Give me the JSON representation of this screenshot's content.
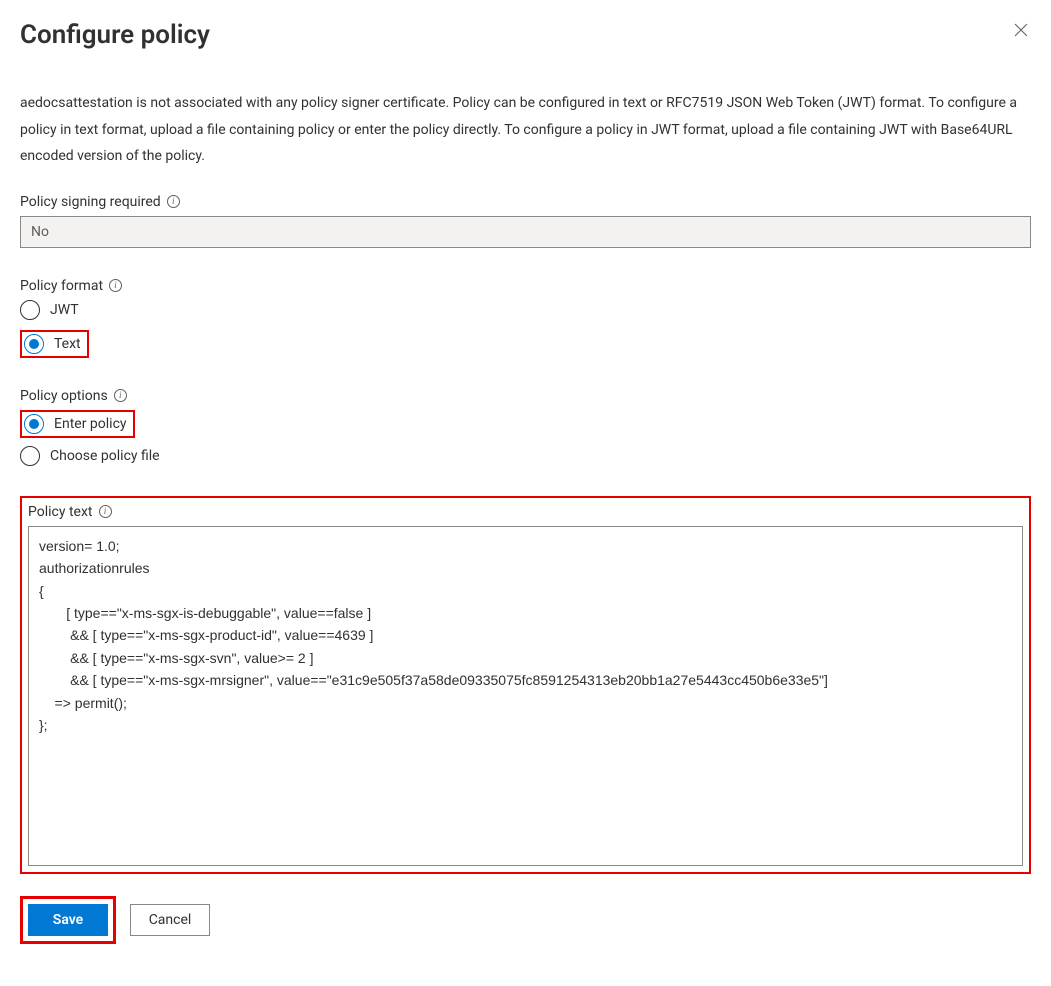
{
  "header": {
    "title": "Configure policy"
  },
  "description": "aedocsattestation is not associated with any policy signer certificate. Policy can be configured in text or RFC7519 JSON Web Token (JWT) format. To configure a policy in text format, upload a file containing policy or enter the policy directly. To configure a policy in JWT format, upload a file containing JWT with Base64URL encoded version of the policy.",
  "signing": {
    "label": "Policy signing required",
    "value": "No"
  },
  "format": {
    "label": "Policy format",
    "options": {
      "jwt": "JWT",
      "text": "Text"
    },
    "selected": "text"
  },
  "options": {
    "label": "Policy options",
    "choices": {
      "enter": "Enter policy",
      "choose": "Choose policy file"
    },
    "selected": "enter"
  },
  "policy_text": {
    "label": "Policy text",
    "value": "version= 1.0;\nauthorizationrules\n{\n       [ type==\"x-ms-sgx-is-debuggable\", value==false ]\n        && [ type==\"x-ms-sgx-product-id\", value==4639 ]\n        && [ type==\"x-ms-sgx-svn\", value>= 2 ]\n        && [ type==\"x-ms-sgx-mrsigner\", value==\"e31c9e505f37a58de09335075fc8591254313eb20bb1a27e5443cc450b6e33e5\"]\n    => permit();\n};"
  },
  "buttons": {
    "save": "Save",
    "cancel": "Cancel"
  }
}
